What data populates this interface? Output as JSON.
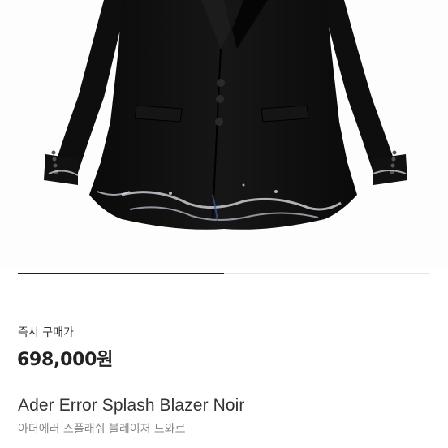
{
  "product": {
    "image_alt": "Ader Error Splash Blazer Noir",
    "image_progress": 0.5,
    "price_label": "즉시 구매가",
    "price": "698,000원",
    "name_en": "Ader Error Splash Blazer Noir",
    "name_kr": "아더에러 스플래쉬 블레이저 느와르"
  }
}
